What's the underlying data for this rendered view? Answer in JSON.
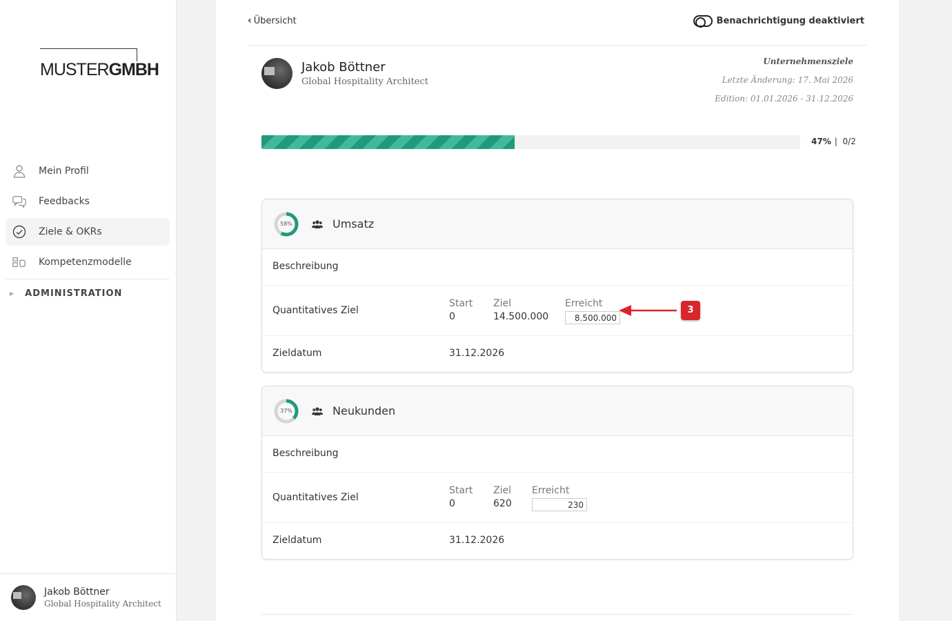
{
  "logo": {
    "part1": "MUSTER",
    "part2": "GMBH"
  },
  "sidebar": {
    "items": [
      {
        "label": "Mein Profil",
        "icon": "user-icon"
      },
      {
        "label": "Feedbacks",
        "icon": "chat-icon"
      },
      {
        "label": "Ziele & OKRs",
        "icon": "check-circle-icon",
        "active": true
      },
      {
        "label": "Kompetenzmodelle",
        "icon": "grid-icon"
      }
    ],
    "admin_label": "ADMINISTRATION"
  },
  "footer_user": {
    "name": "Jakob Böttner",
    "role": "Global Hospitality Architect"
  },
  "topbar": {
    "back_label": "Übersicht",
    "notification_label": "Benachrichtigung deaktiviert"
  },
  "profile": {
    "name": "Jakob Böttner",
    "role": "Global Hospitality Architect"
  },
  "meta": {
    "title": "Unternehmensziele",
    "last_change": "Letzte Änderung: 17. Mai 2026",
    "edition": "Edition: 01.01.2026 - 31.12.2026"
  },
  "progress": {
    "percent": 47,
    "percent_label": "47%",
    "separator": "|",
    "count_label": "0/2"
  },
  "goals": [
    {
      "title": "Umsatz",
      "percent": 58,
      "percent_label": "58%",
      "description_label": "Beschreibung",
      "quant_label": "Quantitatives Ziel",
      "start_label": "Start",
      "start_value": "0",
      "target_label": "Ziel",
      "target_value": "14.500.000",
      "achieved_label": "Erreicht",
      "achieved_value": "8.500.000",
      "date_label": "Zieldatum",
      "date_value": "31.12.2026"
    },
    {
      "title": "Neukunden",
      "percent": 37,
      "percent_label": "37%",
      "description_label": "Beschreibung",
      "quant_label": "Quantitatives Ziel",
      "start_label": "Start",
      "start_value": "0",
      "target_label": "Ziel",
      "target_value": "620",
      "achieved_label": "Erreicht",
      "achieved_value": "230",
      "date_label": "Zieldatum",
      "date_value": "31.12.2026"
    }
  ],
  "callout": {
    "badge": "3",
    "color": "#d9262c"
  },
  "colors": {
    "accent": "#1f9a7e",
    "accent_light": "#44b89c"
  }
}
